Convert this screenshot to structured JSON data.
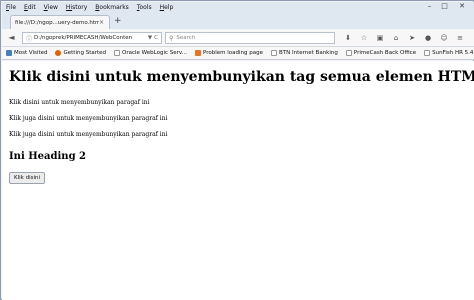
{
  "menubar": {
    "items": [
      {
        "prefix": "F",
        "rest": "ile"
      },
      {
        "prefix": "E",
        "rest": "dit"
      },
      {
        "prefix": "V",
        "rest": "iew"
      },
      {
        "prefix": "Hi",
        "rest": "story"
      },
      {
        "prefix": "B",
        "rest": "ookmarks"
      },
      {
        "prefix": "T",
        "rest": "ools"
      },
      {
        "prefix": "H",
        "rest": "elp"
      }
    ]
  },
  "window_controls": {
    "minimize": "–",
    "maximize": "□",
    "close": "✕"
  },
  "tab": {
    "title": "file:///D:/ngop...uery-demo.html",
    "close": "×",
    "new": "+"
  },
  "navbar": {
    "back": "◄",
    "url": "D:/ngoprek/PRIMECASH/WebConten",
    "url_dropdown": "▼",
    "url_reload": "C",
    "search_placeholder": "Search",
    "icons": [
      "download-icon",
      "bookmark-star-icon",
      "clipboard-icon",
      "home-icon",
      "send-icon",
      "chat-icon",
      "smiley-icon",
      "menu-icon"
    ]
  },
  "bookmarks": [
    {
      "label": "Most Visited",
      "color": "#4a7ebb"
    },
    {
      "label": "Getting Started",
      "color": "#e66000"
    },
    {
      "label": "Oracle WebLogic Serv...",
      "color": "#c0c0c0"
    },
    {
      "label": "Problem loading page",
      "color": "#e8731f"
    },
    {
      "label": "BTN Internet Banking",
      "color": "#c0c0c0"
    },
    {
      "label": "PrimeCash Back Office",
      "color": "#c0c0c0"
    },
    {
      "label": "SunFish HR 5.4",
      "color": "#c0c0c0"
    }
  ],
  "page": {
    "heading1": "Klik disini untuk menyembunyikan tag semua elemen HTML",
    "paragraphs": [
      "Klik disini untuk menyembunyikan paragaf ini",
      "Klik juga disini untuk menyembunyikan paragraf ini",
      "Klik juga disini untuk menyembunyikan paragraf ini"
    ],
    "heading2": "Ini Heading 2",
    "button": "Klik disini"
  }
}
